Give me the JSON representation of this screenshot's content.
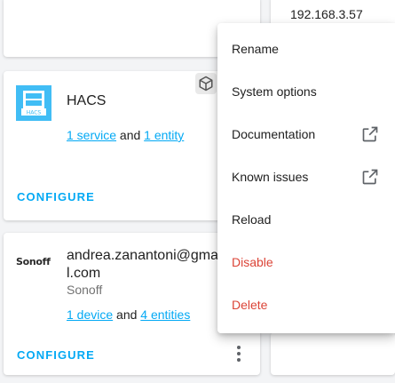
{
  "top_right_card": {
    "ip": "192.168.3.57"
  },
  "hacs": {
    "title": "HACS",
    "services_link": "1 service",
    "and_text": " and ",
    "entities_link": "1 entity",
    "configure": "CONFIGURE",
    "logo_text": "HACS"
  },
  "sonoff": {
    "title": "andrea.zanantoni@gmail.com",
    "manufacturer": "Sonoff",
    "logo_text": "Sonoff",
    "devices_link": "1 device",
    "and_text": " and ",
    "entities_link": "4 entities",
    "configure": "CONFIGURE"
  },
  "menu": {
    "items": [
      {
        "label": "Rename",
        "external": false,
        "danger": false
      },
      {
        "label": "System options",
        "external": false,
        "danger": false
      },
      {
        "label": "Documentation",
        "external": true,
        "danger": false
      },
      {
        "label": "Known issues",
        "external": true,
        "danger": false
      },
      {
        "label": "Reload",
        "external": false,
        "danger": false
      },
      {
        "label": "Disable",
        "external": false,
        "danger": true
      },
      {
        "label": "Delete",
        "external": false,
        "danger": true
      }
    ]
  },
  "colors": {
    "accent": "#03a9f4",
    "danger": "#db4437",
    "hacs_blue": "#41bdf5"
  },
  "icons": [
    "cube-icon",
    "kebab-menu-icon",
    "open-in-new-icon",
    "hacs-logo",
    "sonoff-logo"
  ]
}
